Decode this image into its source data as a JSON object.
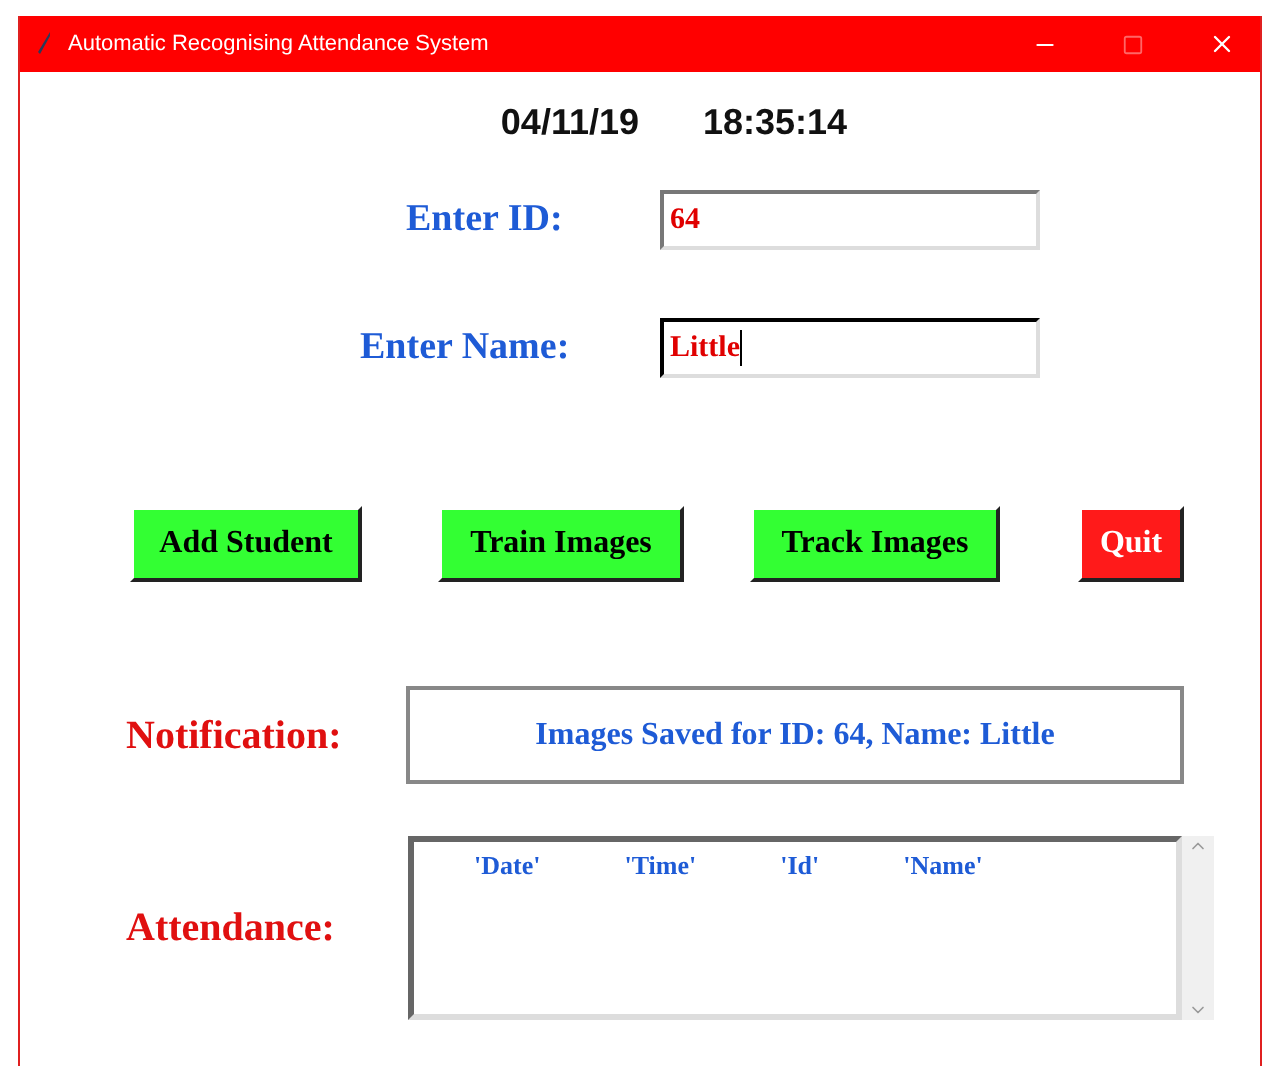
{
  "window": {
    "title": "Automatic Recognising Attendance System"
  },
  "date": "04/11/19",
  "time": "18:35:14",
  "fields": [
    {
      "label": "Enter ID:",
      "value": "64",
      "focused": false
    },
    {
      "label": "Enter Name:",
      "value": "Little",
      "focused": true
    }
  ],
  "buttons": [
    {
      "label": "Add Student",
      "color": "#33ff33"
    },
    {
      "label": "Train Images",
      "color": "#33ff33"
    },
    {
      "label": "Track Images",
      "color": "#33ff33"
    },
    {
      "label": "Quit",
      "color": "#ff1a1a"
    }
  ],
  "notification": {
    "label": "Notification:",
    "message": "Images Saved for ID: 64, Name: Little"
  },
  "attendance": {
    "label": "Attendance:",
    "columns": [
      "'Date'",
      "'Time'",
      "'Id'",
      "'Name'"
    ]
  }
}
